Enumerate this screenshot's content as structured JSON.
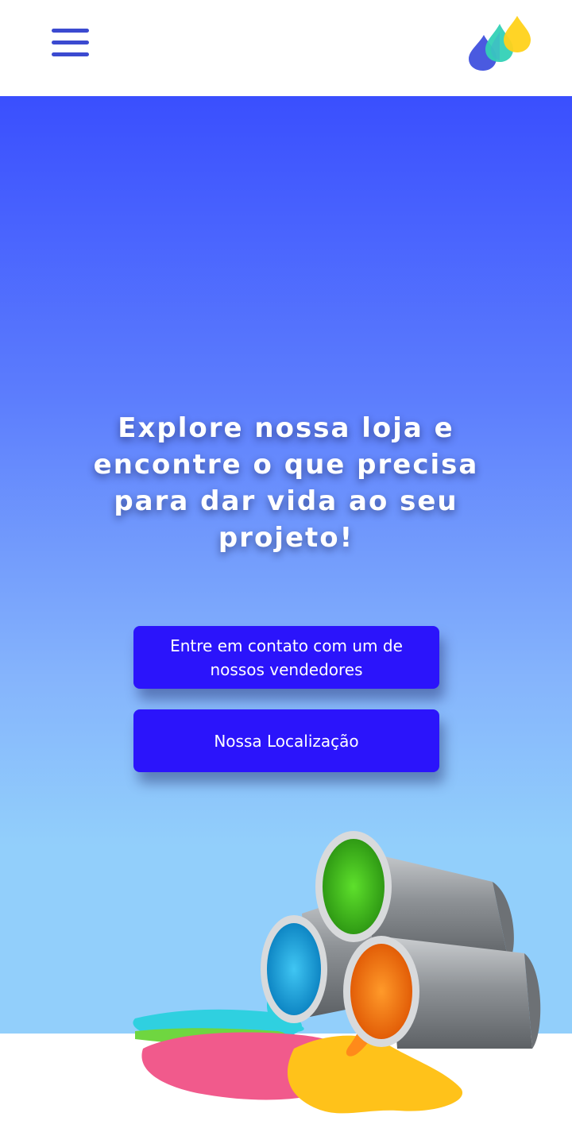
{
  "header": {
    "menu_icon": "hamburger-menu-icon",
    "logo_icon": "paint-drops-logo-icon",
    "colors": {
      "menu": "#3b4ad0",
      "drop_blue": "#4a5ae0",
      "drop_teal": "#33d1b6",
      "drop_yellow": "#ffd21a"
    }
  },
  "hero": {
    "headline": "Explore nossa loja e encontre o que precisa para dar vida ao seu projeto!",
    "buttons": {
      "contact_label": "Entre em contato com um de nossos vendedores",
      "location_label": "Nossa Localização"
    },
    "colors": {
      "gradient_top": "#3a4ffe",
      "gradient_bottom": "#92cffb",
      "button": "#2b14fb"
    },
    "illustration": "spilled-paint-cans-icon"
  }
}
